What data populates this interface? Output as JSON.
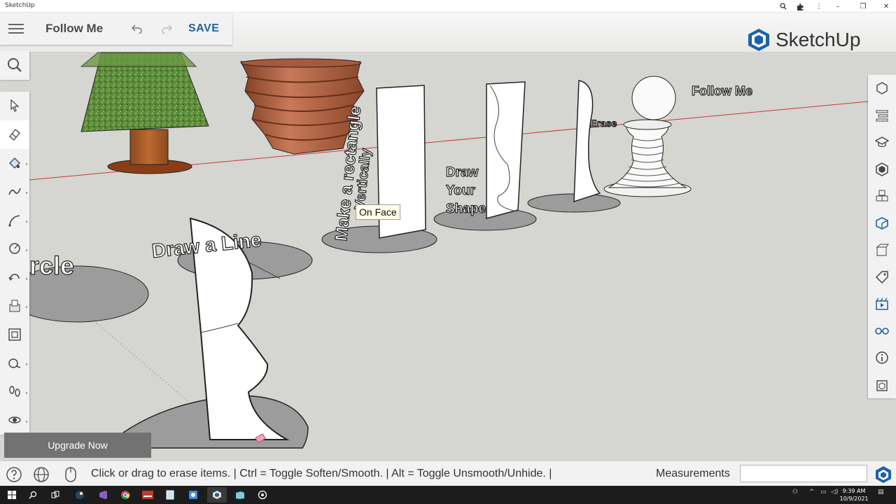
{
  "window": {
    "title": "SketchUp"
  },
  "toolbar": {
    "tool_name": "Follow Me",
    "save_label": "SAVE"
  },
  "brand": {
    "name": "SketchUp",
    "accent": "#1d62a8"
  },
  "scene": {
    "labels": {
      "circle": "rcle",
      "draw_line": "Draw a Line",
      "make_rect": "Make a rectangle",
      "vertically": "Vertically",
      "draw": "Draw",
      "your": "Your",
      "shape": "Shape",
      "erase": "Erase",
      "follow_me": "Follow Me"
    },
    "tooltip": "On Face"
  },
  "left_tools": [
    {
      "icon": "select-icon"
    },
    {
      "icon": "eraser-icon"
    },
    {
      "icon": "paint-bucket-icon"
    },
    {
      "icon": "freehand-icon"
    },
    {
      "icon": "arc-icon"
    },
    {
      "icon": "circle-tool-icon"
    },
    {
      "icon": "rotate-icon"
    },
    {
      "icon": "push-pull-icon"
    },
    {
      "icon": "offset-icon"
    },
    {
      "icon": "tape-measure-icon"
    },
    {
      "icon": "walk-icon"
    },
    {
      "icon": "orbit-icon"
    }
  ],
  "right_tools": [
    {
      "icon": "entity-info-icon"
    },
    {
      "icon": "layers-icon"
    },
    {
      "icon": "instructor-icon"
    },
    {
      "icon": "materials-icon"
    },
    {
      "icon": "components-icon"
    },
    {
      "icon": "styles-icon"
    },
    {
      "icon": "outliner-icon"
    },
    {
      "icon": "tags-icon"
    },
    {
      "icon": "scenes-icon"
    },
    {
      "icon": "display-icon"
    },
    {
      "icon": "info-icon"
    },
    {
      "icon": "solid-inspector-icon"
    }
  ],
  "upgrade": {
    "label": "Upgrade Now"
  },
  "status": {
    "hint": "Click or drag to erase items. | Ctrl = Toggle Soften/Smooth. | Alt = Toggle Unsmooth/Unhide. |",
    "measurements_label": "Measurements",
    "measurements_value": ""
  },
  "taskbar": {
    "time": "9:39 AM",
    "date": "10/9/2021"
  }
}
